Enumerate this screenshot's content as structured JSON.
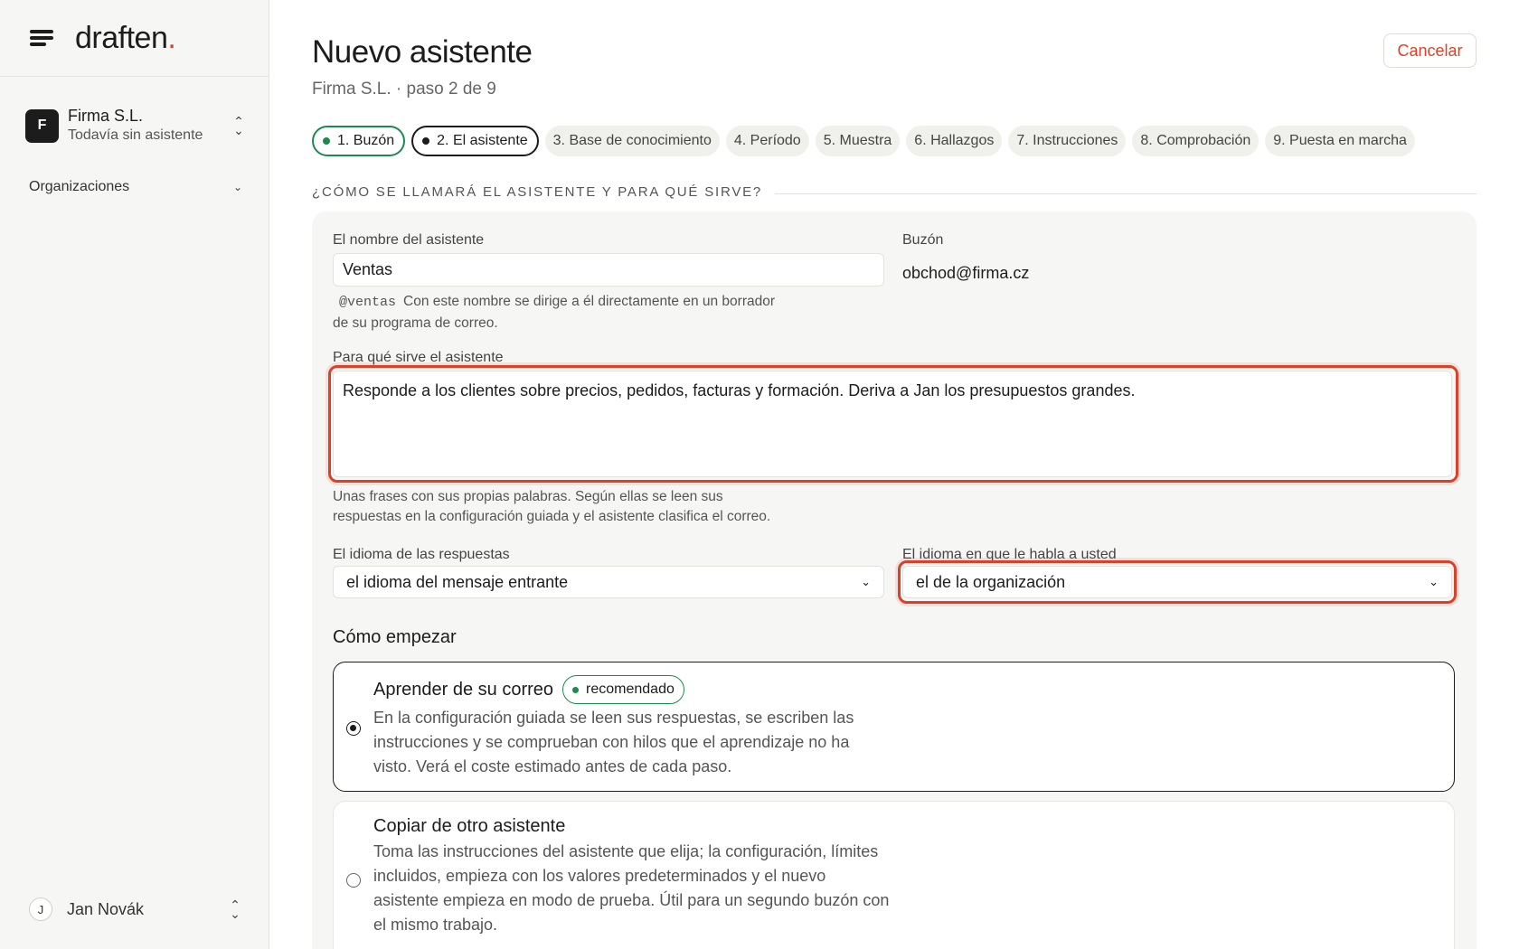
{
  "app": {
    "logo_text": "draften",
    "logo_dot": ".",
    "accent_color": "#d5452b",
    "success_color": "#1a8a4f"
  },
  "sidebar": {
    "org": {
      "initial": "F",
      "name": "Firma S.L.",
      "subtitle": "Todavía sin asistente"
    },
    "nav": [
      {
        "label": "Organizaciones",
        "icon": "chevron-down-icon"
      }
    ],
    "user": {
      "initial": "J",
      "name": "Jan Novák"
    }
  },
  "header": {
    "title": "Nuevo asistente",
    "subtitle": "Firma S.L. · paso 2 de 9",
    "cancel_label": "Cancelar"
  },
  "steps": [
    {
      "label": "1. Buzón",
      "state": "done"
    },
    {
      "label": "2. El asistente",
      "state": "current"
    },
    {
      "label": "3. Base de conocimiento",
      "state": "pending"
    },
    {
      "label": "4. Período",
      "state": "pending"
    },
    {
      "label": "5. Muestra",
      "state": "pending"
    },
    {
      "label": "6. Hallazgos",
      "state": "pending"
    },
    {
      "label": "7. Instrucciones",
      "state": "pending"
    },
    {
      "label": "8. Comprobación",
      "state": "pending"
    },
    {
      "label": "9. Puesta en marcha",
      "state": "pending"
    }
  ],
  "form": {
    "section_title": "¿CÓMO SE LLAMARÁ EL ASISTENTE Y PARA QUÉ SIRVE?",
    "name": {
      "label": "El nombre del asistente",
      "value": "Ventas",
      "handle": "@ventas",
      "hint_line1": "Con este nombre se dirige a él directamente en un borrador",
      "hint_line2": "de su programa de correo."
    },
    "mailbox": {
      "label": "Buzón",
      "value": "obchod@firma.cz"
    },
    "purpose": {
      "label": "Para qué sirve el asistente",
      "value": "Responde a los clientes sobre precios, pedidos, facturas y formación. Deriva a Jan los presupuestos grandes.",
      "hint_line1": "Unas frases con sus propias palabras. Según ellas se leen sus",
      "hint_line2": "respuestas en la configuración guiada y el asistente clasifica el correo."
    },
    "reply_language": {
      "label": "El idioma de las respuestas",
      "value": "el idioma del mensaje entrante"
    },
    "address_language": {
      "label": "El idioma en que le habla a usted",
      "value": "el de la organización"
    }
  },
  "start": {
    "heading": "Cómo empezar",
    "options": [
      {
        "title": "Aprender de su correo",
        "badge": "recomendado",
        "selected": true,
        "desc_lines": [
          "En la configuración guiada se leen sus respuestas, se escriben las",
          "instrucciones y se comprueban con hilos que el aprendizaje no ha",
          "visto. Verá el coste estimado antes de cada paso."
        ]
      },
      {
        "title": "Copiar de otro asistente",
        "selected": false,
        "desc_lines": [
          "Toma las instrucciones del asistente que elija; la configuración, límites",
          "incluidos, empieza con los valores predeterminados y el nuevo",
          "asistente empieza en modo de prueba. Útil para un segundo buzón con",
          "el mismo trabajo."
        ]
      }
    ]
  }
}
